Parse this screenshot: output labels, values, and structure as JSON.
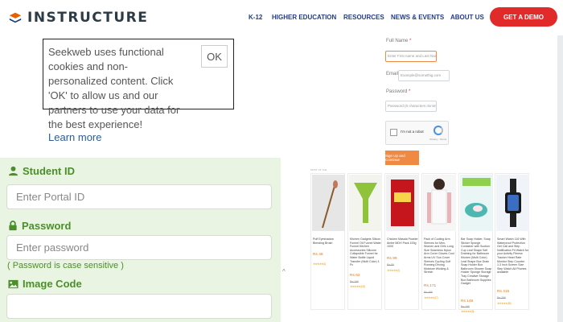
{
  "header": {
    "logo_text": "INSTRUCTURE",
    "nav": [
      "K-12",
      "HIGHER EDUCATION",
      "RESOURCES",
      "NEWS & EVENTS",
      "ABOUT US"
    ],
    "cta": "GET A DEMO"
  },
  "cookie": {
    "text": "Seekweb uses functional cookies and non-personalized content. Click 'OK' to allow us and our partners to use your data for the best experience!",
    "link": "Learn more",
    "ok": "OK"
  },
  "signup": {
    "fullname_label": "Full Name",
    "fullname_placeholder": "Enter First name and Last Name",
    "email_label": "Email",
    "email_placeholder": "Example@somethig.com",
    "password_label": "Password",
    "password_placeholder": "Password (8 characters minimum)",
    "req_mark": "*",
    "captcha_label": "I'm not a robot",
    "captcha_small": "Privacy - Terms",
    "submit": "Sign Up and Continue"
  },
  "login": {
    "student_id_label": "Student ID",
    "portal_placeholder": "Enter Portal ID",
    "password_label": "Password",
    "password_placeholder": "Enter password",
    "password_hint": "( Password is case sensitive )",
    "image_code_label": "Image Code"
  },
  "products": {
    "heading": "MOST OF THE",
    "items": [
      {
        "title": "Puff Eyeshadow Blending Brush",
        "price": "Rs 48",
        "old": "",
        "rating": "★★★★★ (1)",
        "color": "#e6e6e6",
        "accent": "#c07858"
      },
      {
        "title": "Kitchen Gadgets Silicon Funnel Oil Funnel Water Funnel Kitchen Accessories Silicone Collapsible Funnel for Water Bottle Liquid Transfer (Multi Color) 1 Pc",
        "price": "Rs 62",
        "old": "Rs 199",
        "rating": "★★★★★ (142)",
        "color": "#f4f4ee",
        "accent": "#8fc43a"
      },
      {
        "title": "Chicken Masala Powder Ambe MDH Pack 100g 1000",
        "price": "Rs 99",
        "old": "Rs 85",
        "rating": "★★★★★ (1)",
        "color": "#f1f1f1",
        "accent": "#c4161c"
      },
      {
        "title": "Pack of Cooling Arm Sleeves for Men, Women and Girls Long Size Seamless Nylon Arm Cover Gloves Cool Arms UV Sun Cover Sleeves Cycling Golf Running Driving Moisture Wicking & Stretch",
        "price": "Rs 171",
        "old": "Rs 499",
        "rating": "★★★★★ (17)",
        "color": "#f6f6f6",
        "accent": "#e8b4b8"
      },
      {
        "title": "Bar Soap Holder, Soap Sticker Sponge Container with Suction Cup Leaf Shape Self Draining for Bathroom Kitchen (Multi Color) Leaf Shape Box Drain Soap Holder Box Bathroom Shower Soap Holder Sponge Storage Tray Creative Storage Box Bathroom Supplies Gadget",
        "price": "Rs 148",
        "old": "Rs 199",
        "rating": "★★★★★ (5)",
        "color": "#eaf6f6",
        "accent": "#4cb8b0"
      },
      {
        "title": "Smart Watch 116 With Waterproof Protection Get Call and Step Notification Fit Watch for your Activity Fitness Tracker Heart Rate Monitor Step Counter 1.3 Inch Screen Size Step Watch All Phones available",
        "price": "Rs 415",
        "old": "Rs 799",
        "rating": "★★★★★ (82)",
        "color": "#f0f4f8",
        "accent": "#1a1a1a"
      }
    ]
  },
  "misc": {
    "scroll_up": "^"
  },
  "colors": {
    "brand": "#2d3b45",
    "nav": "#1f3c88",
    "cta": "#e12b2b",
    "login_bg": "#eaf4e2",
    "login_green": "#4a8f2a",
    "signup_orange": "#f08a42"
  }
}
